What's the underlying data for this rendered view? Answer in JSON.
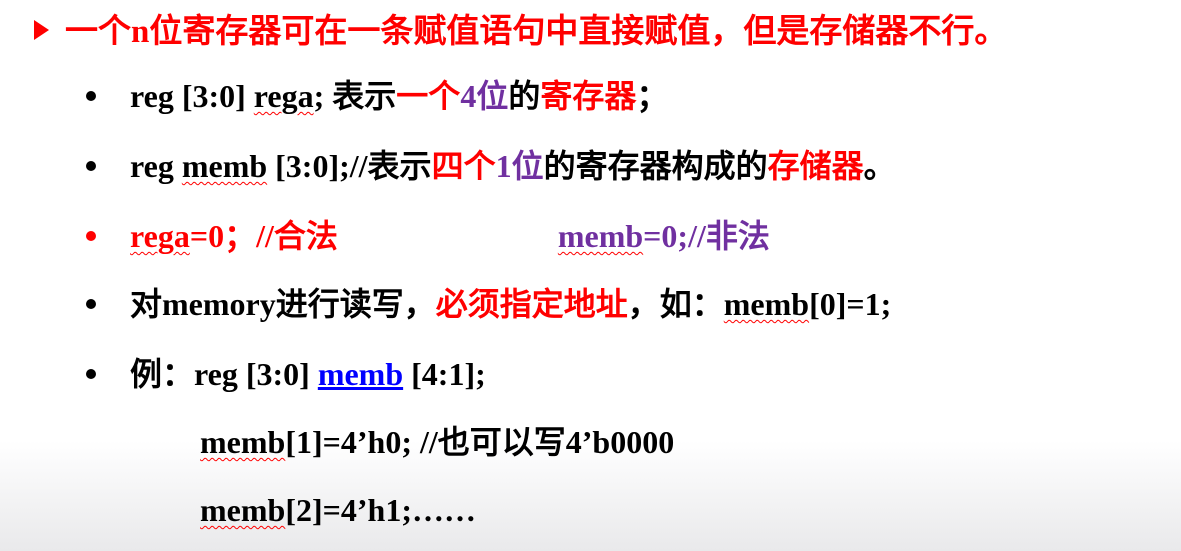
{
  "title": {
    "text": "一个n位寄存器可在一条赋值语句中直接赋值，但是存储器不行。"
  },
  "items": [
    {
      "part1": "reg [3:0] ",
      "rega": "rega",
      "part2": "; 表示",
      "red1": "一个",
      "purple1": "4位",
      "part3": "的",
      "red2": "寄存器",
      "part4": "；"
    },
    {
      "part1": "reg ",
      "memb": "memb",
      "part2": " [3:0];//表示",
      "red1": "四个",
      "purple1": "1位",
      "part3": "的寄存器构成的",
      "red2": "存储器",
      "part4": "。"
    },
    {
      "rega": "rega",
      "left_rest": "=0；//合法",
      "memb": "memb",
      "right_rest": "=0;//非法"
    },
    {
      "part1": "对memory进行读写，",
      "red1": "必须指定地址",
      "part2": "，如：",
      "memb": "memb",
      "part3": "[0]=1;"
    },
    {
      "part1": "例：reg [3:0] ",
      "memb": "memb",
      "part2": " [4:1];"
    }
  ],
  "lines": [
    {
      "memb": "memb",
      "rest": "[1]=4’h0; //也可以写4’b0000"
    },
    {
      "memb": "memb",
      "rest": "[2]=4’h1;……"
    }
  ],
  "colors": {
    "red": "#ff0000",
    "purple": "#7030a0",
    "blue": "#0000ff",
    "text": "#000000"
  }
}
